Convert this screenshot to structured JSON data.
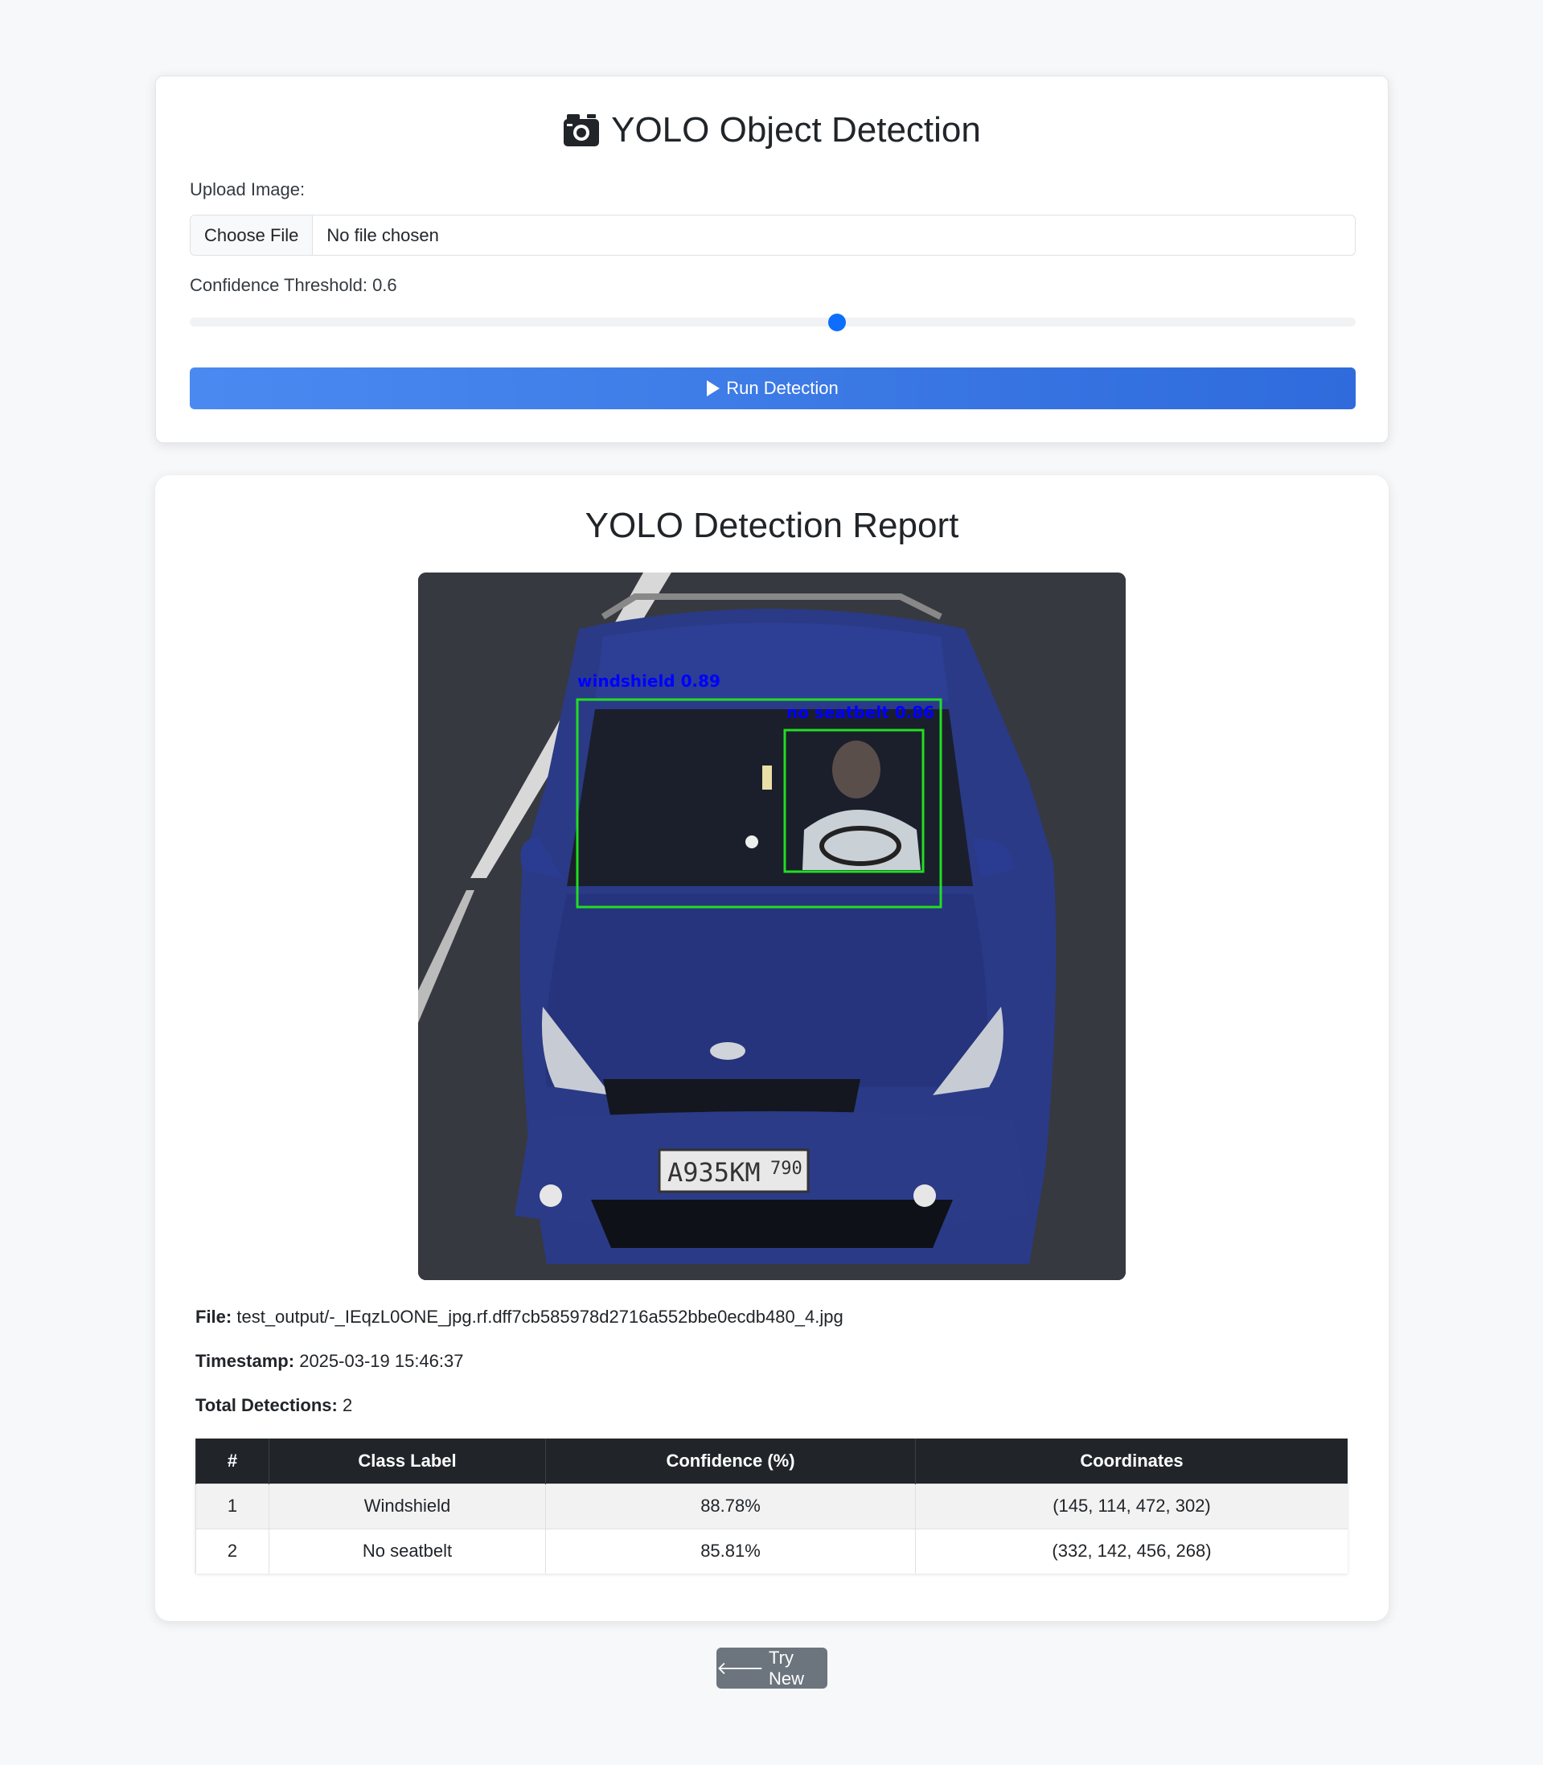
{
  "upload": {
    "title": "YOLO Object Detection",
    "upload_label": "Upload Image:",
    "choose_file_label": "Choose File",
    "file_name": "No file chosen",
    "confidence_label": "Confidence Threshold: 0.6",
    "confidence_value": 0.6,
    "slider_fraction": 0.555,
    "run_label": "Run Detection"
  },
  "report": {
    "title": "YOLO Detection Report",
    "image": {
      "plate_text": "A935KM",
      "plate_region": "790",
      "boxes": [
        {
          "label": "windshield 0.89",
          "color": "#22dd22"
        },
        {
          "label": "no seatbelt 0.86",
          "color": "#22dd22"
        }
      ]
    },
    "file_label": "File:",
    "file_value": "test_output/-_IEqzL0ONE_jpg.rf.dff7cb585978d2716a552bbe0ecdb480_4.jpg",
    "timestamp_label": "Timestamp:",
    "timestamp_value": "2025-03-19 15:46:37",
    "total_label": "Total Detections:",
    "total_value": "2",
    "table": {
      "headers": [
        "#",
        "Class Label",
        "Confidence (%)",
        "Coordinates"
      ],
      "rows": [
        [
          "1",
          "Windshield",
          "88.78%",
          "(145, 114, 472, 302)"
        ],
        [
          "2",
          "No seatbelt",
          "85.81%",
          "(332, 142, 456, 268)"
        ]
      ]
    }
  },
  "footer": {
    "try_new_label": "Try New"
  },
  "colors": {
    "primary": "#0d6efd",
    "header_dark": "#212529",
    "secondary_button": "#6c757d",
    "box_green": "#22dd22",
    "label_blue": "#0000ff"
  }
}
